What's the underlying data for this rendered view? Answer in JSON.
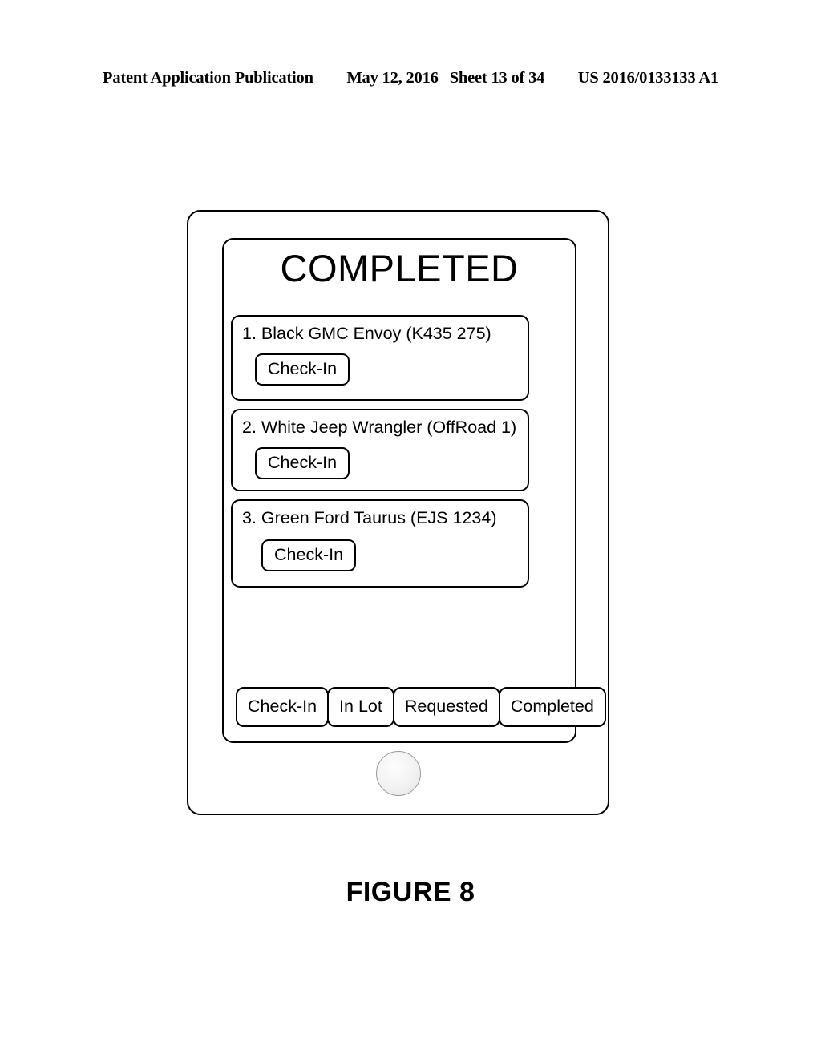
{
  "patent_header": {
    "publication": "Patent Application Publication",
    "date": "May 12, 2016",
    "sheet": "Sheet 13 of 34",
    "number": "US 2016/0133133 A1"
  },
  "figure": {
    "caption": "FIGURE 8"
  },
  "device": {
    "screen": {
      "title": "COMPLETED",
      "vehicles": [
        {
          "label": "1. Black GMC Envoy (K435 275)",
          "action_label": "Check-In"
        },
        {
          "label": "2. White Jeep Wrangler (OffRoad 1)",
          "action_label": "Check-In"
        },
        {
          "label": "3. Green Ford Taurus (EJS 1234)",
          "action_label": "Check-In"
        }
      ],
      "tabs": [
        {
          "label": "Check-In",
          "selected": false
        },
        {
          "label": "In Lot",
          "selected": false
        },
        {
          "label": "Requested",
          "selected": false
        },
        {
          "label": "Completed",
          "selected": true
        }
      ]
    },
    "home_button": "home-button"
  },
  "colors": {
    "ink": "#000000",
    "paper": "#ffffff",
    "home_button_border": "#9a9a9a"
  }
}
